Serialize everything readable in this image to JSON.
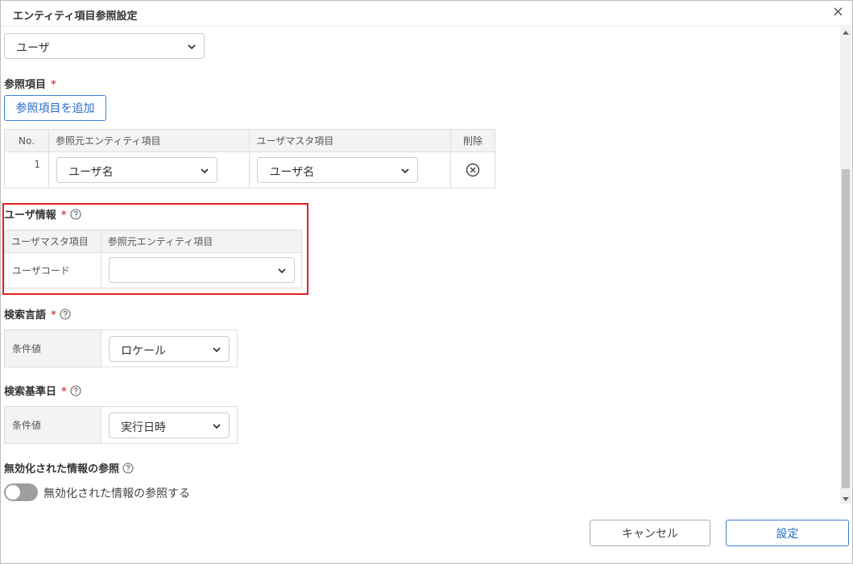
{
  "dialog": {
    "title": "エンティティ項目参照設定",
    "close_label": "×"
  },
  "top_select": {
    "value": "ユーザ"
  },
  "reference_items": {
    "label": "参照項目",
    "required_mark": "*",
    "add_button": "参照項目を追加",
    "columns": [
      "No.",
      "参照元エンティティ項目",
      "ユーザマスタ項目",
      "削除"
    ],
    "rows": [
      {
        "no": "1",
        "source": "ユーザ名",
        "target": "ユーザ名"
      }
    ]
  },
  "user_info": {
    "label": "ユーザ情報",
    "required_mark": "*",
    "columns": [
      "ユーザマスタ項目",
      "参照元エンティティ項目"
    ],
    "rows": [
      {
        "key": "ユーザコード",
        "value": ""
      }
    ]
  },
  "search_language": {
    "label": "検索言語",
    "required_mark": "*",
    "key": "条件値",
    "value": "ロケール"
  },
  "search_date": {
    "label": "検索基準日",
    "required_mark": "*",
    "key": "条件値",
    "value": "実行日時"
  },
  "disabled_ref": {
    "label": "無効化された情報の参照",
    "toggle_label": "無効化された情報の参照する",
    "toggle_on": false
  },
  "footer": {
    "cancel": "キャンセル",
    "ok": "設定"
  },
  "colors": {
    "accent": "#3b7dd8",
    "required": "#d9534f",
    "highlight": "#e02020"
  }
}
